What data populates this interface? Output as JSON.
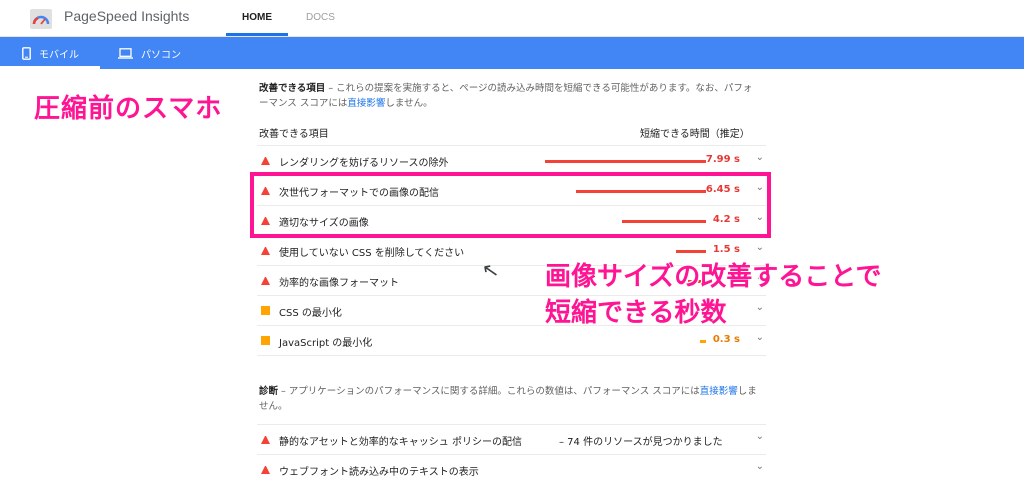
{
  "header": {
    "app_title": "PageSpeed Insights",
    "tabs": [
      {
        "label": "HOME",
        "active": true
      },
      {
        "label": "DOCS",
        "active": false
      }
    ]
  },
  "device_bar": {
    "mobile_label": "モバイル",
    "desktop_label": "パソコン"
  },
  "overlay": {
    "left_caption": "圧縮前のスマホ",
    "right_caption_line1": "画像サイズの改善することで",
    "right_caption_line2": "短縮できる秒数"
  },
  "opportunities": {
    "title": "改善できる項目",
    "description": " – これらの提案を実施すると、ページの読み込み時間を短縮できる可能性があります。なお、パフォーマンス スコアには",
    "link": "直接影響",
    "description_end": "しません。",
    "col_item": "改善できる項目",
    "col_time": "短縮できる時間（推定）",
    "rows": [
      {
        "label": "レンダリングを妨げるリソースの除外",
        "value": "7.99 s",
        "severity": "red",
        "fraction": 0.92
      },
      {
        "label": "次世代フォーマットでの画像の配信",
        "value": "6.45 s",
        "severity": "red",
        "fraction": 0.74
      },
      {
        "label": "適切なサイズの画像",
        "value": "4.2 s",
        "severity": "red",
        "fraction": 0.48
      },
      {
        "label": "使用していない CSS を削除してください",
        "value": "1.5 s",
        "severity": "red",
        "fraction": 0.17
      },
      {
        "label": "効率的な画像フォーマット",
        "value": "",
        "severity": "red",
        "fraction": 0.1
      },
      {
        "label": "CSS の最小化",
        "value": "",
        "severity": "orange",
        "fraction": 0.0
      },
      {
        "label": "JavaScript の最小化",
        "value": "0.3 s",
        "severity": "orange",
        "fraction": 0.03
      }
    ]
  },
  "diagnostics": {
    "title": "診断",
    "description": " – アプリケーションのパフォーマンスに関する詳細。これらの数値は、パフォーマンス スコアには",
    "link_part1": "直接",
    "link_part2": "影響",
    "description_end": "しません。",
    "rows": [
      {
        "label": "静的なアセットと効率的なキャッシュ ポリシーの配信",
        "value": "– 74 件のリソースが見つかりました"
      },
      {
        "label": "ウェブフォント読み込み中のテキストの表示",
        "value": ""
      }
    ]
  },
  "colors": {
    "brand_blue": "#4285f4",
    "accent_magenta": "#ff1493",
    "fail_red": "#f44336",
    "average_orange": "#ffa400"
  }
}
